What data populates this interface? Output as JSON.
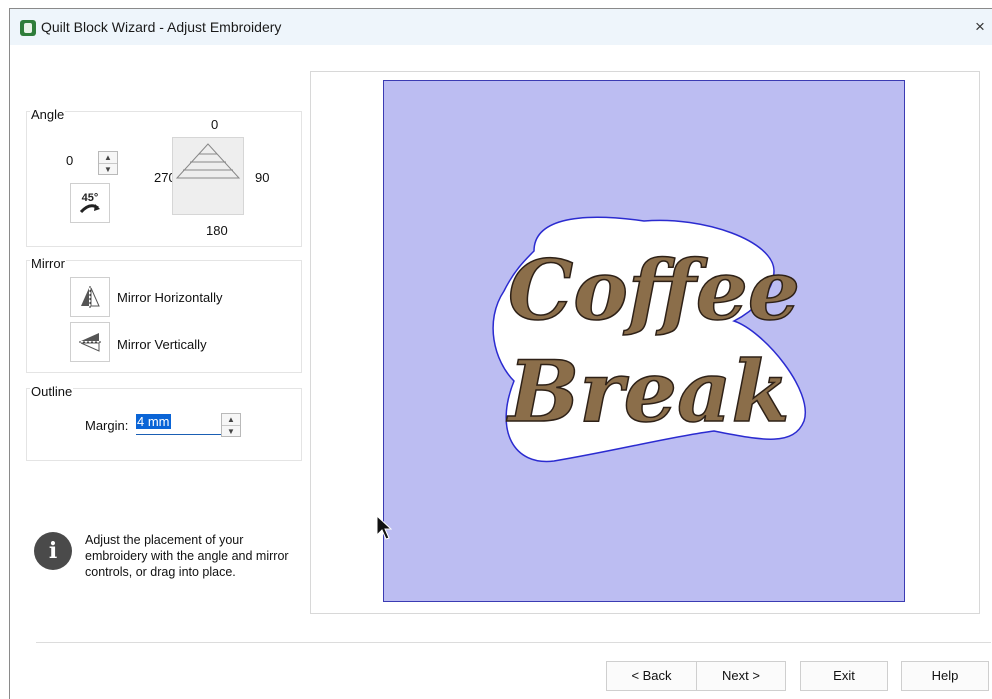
{
  "window": {
    "title": "Quilt Block Wizard - Adjust Embroidery",
    "close_glyph": "×"
  },
  "angle": {
    "group_label": "Angle",
    "value": "0",
    "rotate_button_text": "45°",
    "dial_labels": {
      "top": "0",
      "left": "270",
      "right": "90",
      "bottom": "180"
    }
  },
  "mirror": {
    "group_label": "Mirror",
    "horizontal_label": "Mirror Horizontally",
    "vertical_label": "Mirror Vertically"
  },
  "outline": {
    "group_label": "Outline",
    "margin_label": "Margin:",
    "margin_value": "4 mm"
  },
  "info": {
    "icon": "info-icon",
    "text": "Adjust the placement of your embroidery with the angle and mirror controls, or drag into place."
  },
  "preview": {
    "block_color": "#bcbdf2",
    "block_border_color": "#3b3bb3",
    "design_text_line1": "Coffee",
    "design_text_line2": "Break"
  },
  "buttons": {
    "back": "< Back",
    "next": "Next >",
    "exit": "Exit",
    "help": "Help"
  }
}
